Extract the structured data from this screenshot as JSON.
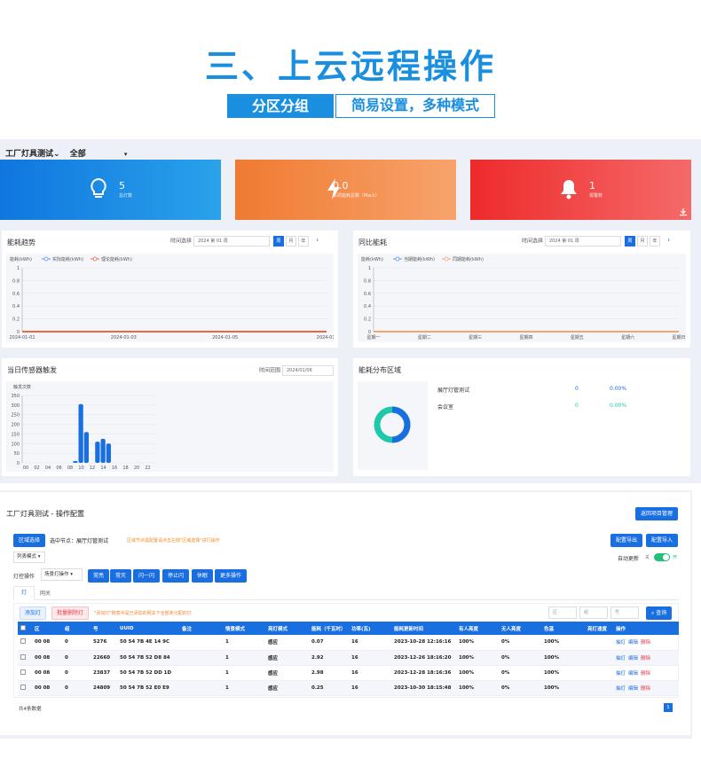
{
  "hero": {
    "title": "三、上云远程操作",
    "tag_left": "分区分组",
    "tag_right": "简易设置，多种模式"
  },
  "topbar": {
    "app_name": "工厂灯具测试",
    "caret": "⌄",
    "scope": "全部"
  },
  "stats": [
    {
      "value": "5",
      "label": "总灯数",
      "icon": "bulb-icon",
      "color_from": "#0f76df",
      "color_to": "#2aa2ea"
    },
    {
      "value": "0.0",
      "label": "本周能耗总数（Mw.h）",
      "icon": "lightning-icon",
      "color_from": "#f07a31",
      "color_to": "#f7a36c"
    },
    {
      "value": "1",
      "label": "报警数",
      "icon": "bell-icon",
      "color_from": "#ee2a2a",
      "color_to": "#f56a6a"
    }
  ],
  "energy_trend": {
    "title": "能耗趋势",
    "time_label": "时间选择",
    "date": "2024 第 01 周",
    "btn_week": "周",
    "btn_month": "月",
    "btn_year": "年",
    "chart_data": {
      "type": "line",
      "ylabel": "能耗(kWh)",
      "x": [
        "2024-01-01",
        "2024-01-03",
        "2024-01-05",
        "2024-01-"
      ],
      "yticks": [
        "1",
        "0.8",
        "0.6",
        "0.4",
        "0.2",
        "0"
      ],
      "ylim": [
        0,
        1
      ],
      "series": [
        {
          "name": "实际能耗(kWh)",
          "color": "#5b8ff9",
          "values": [
            0,
            0,
            0,
            0
          ]
        },
        {
          "name": "理论能耗(kWh)",
          "color": "#e8684a",
          "values": [
            0,
            0,
            0,
            0
          ]
        }
      ],
      "grid": true
    }
  },
  "yoy_energy": {
    "title": "同比能耗",
    "time_label": "时间选择",
    "date": "2024 第 01 周",
    "btn_week": "周",
    "btn_month": "月",
    "btn_year": "年",
    "chart_data": {
      "type": "line",
      "ylabel": "能耗(kWh)",
      "x": [
        "星期一",
        "星期二",
        "星期三",
        "星期四",
        "星期五",
        "星期六",
        "星期日"
      ],
      "yticks": [
        "1",
        "0.8",
        "0.6",
        "0.4",
        "0.2",
        "0"
      ],
      "ylim": [
        0,
        1
      ],
      "series": [
        {
          "name": "当期能耗(kWh)",
          "color": "#5b8ff9",
          "values": [
            0,
            0,
            0,
            0,
            0,
            0,
            0
          ]
        },
        {
          "name": "同期能耗(kWh)",
          "color": "#f6a26b",
          "values": [
            0,
            0,
            0,
            0,
            0,
            0,
            0
          ]
        }
      ],
      "grid": true
    }
  },
  "sensor": {
    "title": "当日传感器触发",
    "time_label": "时间范围",
    "date": "2024/01/06",
    "chart_data": {
      "type": "bar",
      "ylabel": "触发次数",
      "categories": [
        "00",
        "02",
        "04",
        "06",
        "08",
        "10",
        "12",
        "14",
        "16",
        "18",
        "20",
        "22"
      ],
      "yticks": [
        "350",
        "300",
        "250",
        "200",
        "150",
        "100",
        "50",
        "0"
      ],
      "ylim": [
        0,
        350
      ],
      "bars": [
        {
          "x": 9,
          "value": 10
        },
        {
          "x": 10,
          "value": 305
        },
        {
          "x": 11,
          "value": 160
        },
        {
          "x": 13,
          "value": 110
        },
        {
          "x": 14,
          "value": 125
        },
        {
          "x": 15,
          "value": 100
        }
      ],
      "color": "#1a6fe0"
    }
  },
  "distribution": {
    "title": "能耗分布区域",
    "rows": [
      {
        "name": "展厅灯管测试",
        "value": "0",
        "pct": "0.00%"
      },
      {
        "name": "会议室",
        "value": "0",
        "pct": "0.00%"
      }
    ]
  },
  "ops": {
    "title": "工厂灯具测试 - 操作配置",
    "back_btn": "返回项目管理",
    "region_btn": "区域选择",
    "current_node": "选中节点：展厅灯管测试",
    "hint": "区域节点需配置请点击左侧\"区域选择\"进行操作",
    "export_btn": "配置导出",
    "import_btn": "配置导入",
    "list_mode": "列表模式",
    "auto_refresh": "自动更新",
    "off_label": "关",
    "on_label": "开",
    "light_op_label": "灯控操作",
    "light_op_select": "场景灯操作",
    "ops_buttons": [
      "常亮",
      "常灭",
      "闪一闪",
      "停止闪",
      "休眠",
      "更多操作"
    ],
    "tabs": [
      "灯",
      "网关"
    ],
    "add_btn": "添加灯",
    "batch_delete_btn": "批量删除灯",
    "add_hint": "\"添加灯\"随意中是已添加的网关下全部未分配的灯",
    "search_placeholders": [
      "区",
      "组",
      "号"
    ],
    "search_btn": "查询",
    "columns": [
      "区",
      "组",
      "号",
      "UUID",
      "备注",
      "情景模式",
      "亮灯模式",
      "能耗（千瓦时）",
      "功率(瓦)",
      "能耗更新时间",
      "有人亮度",
      "无人亮度",
      "色温",
      "亮灯速度",
      "操作"
    ],
    "rows": [
      [
        "00 08",
        "0",
        "5276",
        "50 54 7B 4E 14 9C",
        "",
        "1",
        "感应",
        "0.07",
        "16",
        "2023-10-28 12:16:16",
        "100%",
        "0%",
        "100%",
        ""
      ],
      [
        "00 08",
        "0",
        "22660",
        "50 54 7B 52 D8 84",
        "",
        "1",
        "感应",
        "2.92",
        "16",
        "2023-12-26 18:16:20",
        "100%",
        "0%",
        "100%",
        ""
      ],
      [
        "00 08",
        "0",
        "23837",
        "50 54 7B 52 DD 1D",
        "",
        "1",
        "感应",
        "2.98",
        "16",
        "2023-12-28 18:16:36",
        "100%",
        "0%",
        "100%",
        ""
      ],
      [
        "00 08",
        "0",
        "24809",
        "50 54 7B 52 E0 E9",
        "",
        "1",
        "感应",
        "0.25",
        "16",
        "2023-10-30 18:15:48",
        "100%",
        "0%",
        "100%",
        ""
      ]
    ],
    "row_actions": [
      "抽灯",
      "编辑",
      "删除"
    ],
    "total": "共4条数据",
    "page": "1"
  }
}
